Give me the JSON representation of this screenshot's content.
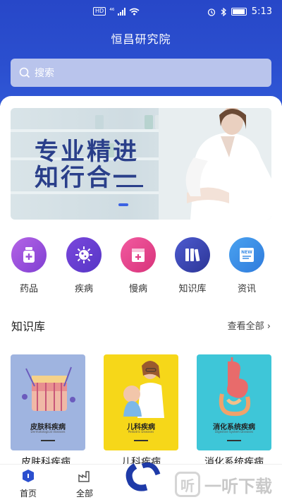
{
  "status": {
    "hd": "HD",
    "network": "⁴⁶",
    "time": "5:13"
  },
  "header": {
    "title": "恒昌研究院"
  },
  "search": {
    "placeholder": "搜索"
  },
  "banner": {
    "line1": "专业精进",
    "line2": "知行合一"
  },
  "categories": [
    {
      "label": "药品",
      "icon": "medicine-bottle-icon",
      "color": "#9b4fd8"
    },
    {
      "label": "疾病",
      "icon": "virus-icon",
      "color": "#6a3fd0"
    },
    {
      "label": "慢病",
      "icon": "medical-folder-icon",
      "color": "#e23f86"
    },
    {
      "label": "知识库",
      "icon": "books-icon",
      "color": "#3d4ab8"
    },
    {
      "label": "资讯",
      "icon": "news-icon",
      "color": "#3c8ee6"
    }
  ],
  "section": {
    "title": "知识库",
    "more": "查看全部 ›"
  },
  "knowledge": [
    {
      "cover_title": "皮肤科疾病",
      "cover_sub": "Dermatological diseases",
      "name": "皮肤科疾病",
      "bg": "#9fb4e0"
    },
    {
      "cover_title": "儿科疾病",
      "cover_sub": "Pediatric Diseases",
      "name": "儿科疾病",
      "bg": "#f6d719"
    },
    {
      "cover_title": "消化系统疾病",
      "cover_sub": "Digestive System Diseases",
      "name": "消化系统疾病",
      "bg": "#3ec6d8"
    }
  ],
  "tabbar": {
    "home": "首页",
    "all": "全部"
  },
  "watermark": {
    "text": "一听下载",
    "logo": "听"
  }
}
